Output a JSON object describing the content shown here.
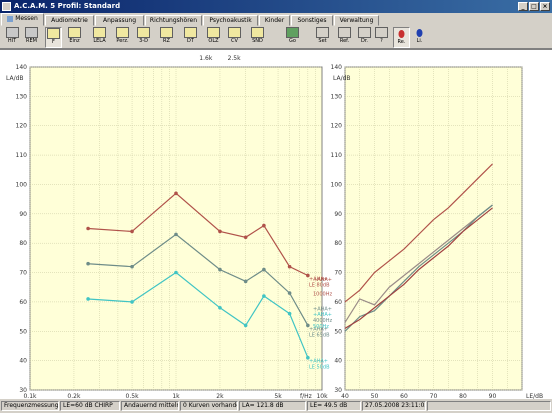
{
  "window": {
    "title": "A.C.A.M. 5  Profil: Standard",
    "min": "_",
    "max": "□",
    "close": "×"
  },
  "tabs": [
    "Messen",
    "Audiometrie",
    "Anpassung",
    "Richtungshören",
    "Psychoakustik",
    "Kinder",
    "Sonstiges",
    "Verwaltung"
  ],
  "toolbar": {
    "hit": "HIT",
    "rem": "REM",
    "f": "F",
    "einz": "Einz",
    "lela": "LELA",
    "perz": "Perz.",
    "threeD": "3-D",
    "rz": "RZ",
    "dt": "DT",
    "olz": "OLZ",
    "cv": "CV",
    "snd": "SND",
    "go": "Go",
    "set": "Set",
    "ref": "Ref.",
    "dr": "Dr.",
    "help": "?",
    "re": "Re.",
    "li": "Li."
  },
  "status": {
    "mode": "Frequenzmessung",
    "level": "LE=60 dB CHIRP",
    "averaging": "Andauernd mitteln",
    "curves": "0 Kurven vorhanden",
    "la": "LA= 121.8 dB",
    "le": "LE= 49.5 dB",
    "datetime": "27.05.2008 23:11:05"
  },
  "chart_data": [
    {
      "type": "line",
      "title": "",
      "xlabel": "f/Hz",
      "ylabel": "LA/dB",
      "xscale": "log",
      "xlim": [
        100,
        10000
      ],
      "ylim": [
        30,
        140
      ],
      "xticks": [
        "0.1k",
        "0.2k",
        "0.5k",
        "1k",
        "2k",
        "5k",
        "10k"
      ],
      "xtick_values": [
        100,
        200,
        500,
        1000,
        2000,
        5000,
        10000
      ],
      "top_ticks": [
        "1.6k",
        "2.5k"
      ],
      "top_tick_values": [
        1600,
        2500
      ],
      "yticks": [
        30,
        40,
        50,
        60,
        70,
        80,
        90,
        100,
        110,
        120,
        130,
        140
      ],
      "grid": true,
      "series": [
        {
          "color": "#b0524a",
          "label": "+AHA+ LE 80dB",
          "x": [
            250,
            500,
            1000,
            2000,
            3000,
            4000,
            6000,
            8000
          ],
          "y": [
            85,
            84,
            97,
            84,
            82,
            86,
            72,
            69
          ]
        },
        {
          "color": "#6e8c88",
          "label": "+AHA+ LE 65dB",
          "x": [
            250,
            500,
            1000,
            2000,
            3000,
            4000,
            6000,
            8000
          ],
          "y": [
            73,
            72,
            83,
            71,
            67,
            71,
            63,
            52
          ]
        },
        {
          "color": "#40c4c4",
          "label": "+AHA+ LE 50dB",
          "x": [
            250,
            500,
            1000,
            2000,
            3000,
            4000,
            6000,
            8000
          ],
          "y": [
            61,
            60,
            70,
            58,
            52,
            62,
            56,
            41
          ]
        }
      ],
      "extra_labels": [
        "+AHA+",
        "1000Hz",
        "+AHA+",
        "4000Hz",
        "+AHA+",
        "500Hz"
      ]
    },
    {
      "type": "line",
      "title": "",
      "xlabel": "LE/dB",
      "ylabel": "LA/dB",
      "xlim": [
        40,
        100
      ],
      "ylim": [
        30,
        140
      ],
      "xticks": [
        40,
        50,
        60,
        70,
        80,
        90
      ],
      "yticks": [
        30,
        40,
        50,
        60,
        70,
        80,
        90,
        100,
        110,
        120,
        130,
        140
      ],
      "grid": true,
      "series": [
        {
          "color": "#b0524a",
          "x": [
            40,
            45,
            50,
            55,
            60,
            65,
            70,
            75,
            80,
            85,
            90
          ],
          "y": [
            60,
            64,
            70,
            74,
            78,
            83,
            88,
            92,
            97,
            102,
            107
          ]
        },
        {
          "color": "#9a8c88",
          "x": [
            40,
            45,
            50,
            55,
            60,
            65,
            70,
            75,
            80,
            85,
            90
          ],
          "y": [
            53,
            61,
            59,
            65,
            69,
            73,
            77,
            81,
            85,
            89,
            93
          ]
        },
        {
          "color": "#6e8c88",
          "x": [
            40,
            45,
            50,
            55,
            60,
            65,
            70,
            75,
            80,
            85,
            90
          ],
          "y": [
            50,
            55,
            57,
            62,
            67,
            72,
            76,
            80,
            84,
            89,
            93
          ]
        },
        {
          "color": "#a04040",
          "x": [
            40,
            45,
            50,
            55,
            60,
            65,
            70,
            75,
            80,
            85,
            90
          ],
          "y": [
            51,
            54,
            58,
            62,
            66,
            71,
            75,
            79,
            84,
            88,
            92
          ]
        }
      ]
    }
  ]
}
